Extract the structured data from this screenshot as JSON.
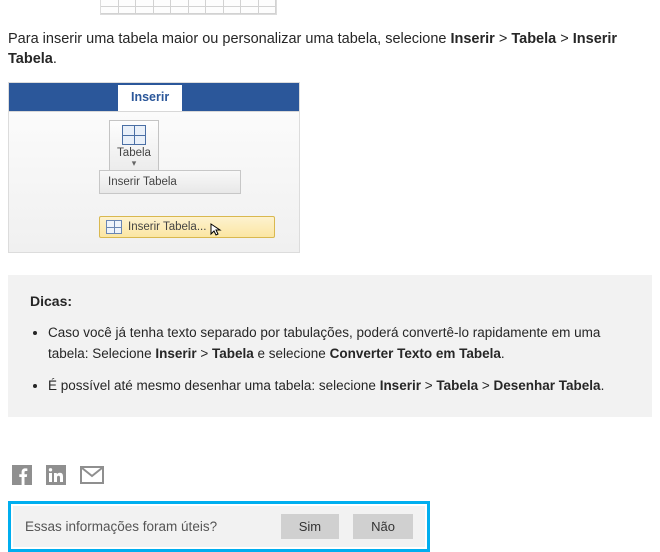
{
  "intro": {
    "prefix": "Para inserir uma tabela maior ou personalizar uma tabela, selecione ",
    "path1": "Inserir",
    "sep": " > ",
    "path2": "Tabela",
    "path3": "Inserir Tabela",
    "suffix": "."
  },
  "ribbon": {
    "tab_label": "Inserir",
    "table_button": "Tabela",
    "dropdown_header": "Inserir Tabela",
    "dropdown_item": "Inserir Tabela..."
  },
  "tips": {
    "heading": "Dicas:",
    "items": [
      {
        "t1": "Caso você já tenha texto separado por tabulações, poderá convertê-lo rapidamente em uma tabela: Selecione ",
        "b1": "Inserir",
        "sep": " > ",
        "b2": "Tabela",
        "mid": " e selecione ",
        "b3": "Converter Texto em Tabela",
        "end": "."
      },
      {
        "t1": "É possível até mesmo desenhar uma tabela: selecione ",
        "b1": "Inserir",
        "sep": " > ",
        "b2": "Tabela",
        "sep2": " > ",
        "b3": "Desenhar Tabela",
        "end": "."
      }
    ]
  },
  "feedback": {
    "question": "Essas informações foram úteis?",
    "yes": "Sim",
    "no": "Não"
  }
}
